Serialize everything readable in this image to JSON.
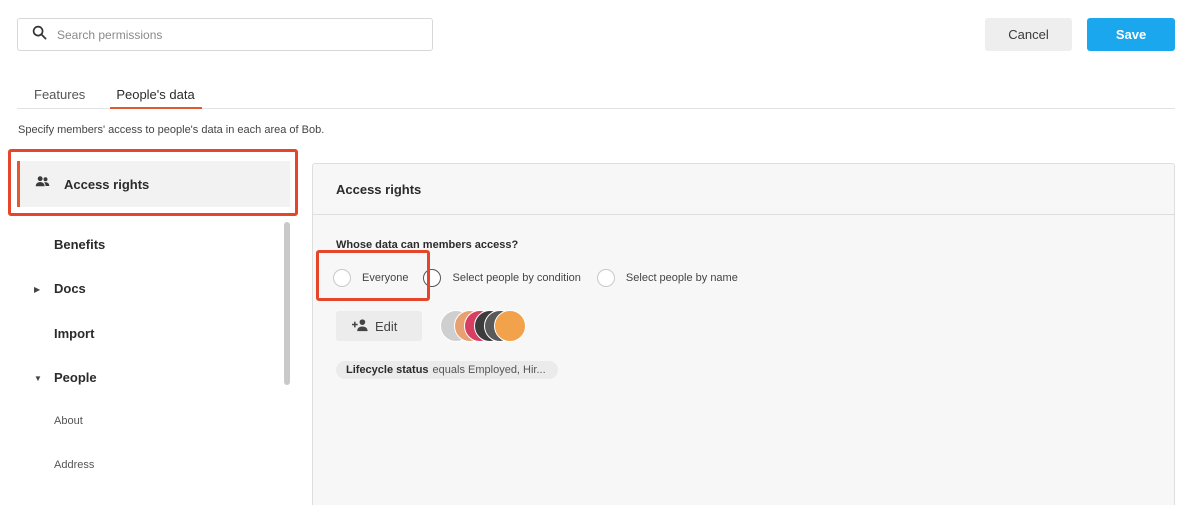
{
  "search": {
    "placeholder": "Search permissions"
  },
  "actions": {
    "cancel_label": "Cancel",
    "save_label": "Save",
    "save_color": "#1aa7ee"
  },
  "tabs": [
    {
      "label": "Features",
      "active": false
    },
    {
      "label": "People's data",
      "active": true
    }
  ],
  "description": "Specify members' access to people's data in each area of Bob.",
  "sidebar": {
    "active_item": {
      "label": "Access rights",
      "icon": "people-icon"
    },
    "items": [
      {
        "label": "Benefits"
      },
      {
        "label": "Docs",
        "expander": "collapsed"
      },
      {
        "label": "Import"
      },
      {
        "label": "People",
        "expander": "expanded"
      }
    ],
    "sub_items": [
      {
        "label": "About"
      },
      {
        "label": "Address"
      }
    ]
  },
  "panel": {
    "title": "Access rights",
    "question": "Whose data can members access?",
    "options": [
      {
        "label": "Everyone"
      },
      {
        "label": "Select people by condition"
      },
      {
        "label": "Select people by name"
      }
    ],
    "edit_label": "Edit",
    "condition_chip": {
      "field": "Lifecycle status",
      "rest": "equals Employed, Hir..."
    }
  },
  "highlight_color": "#e5452a"
}
